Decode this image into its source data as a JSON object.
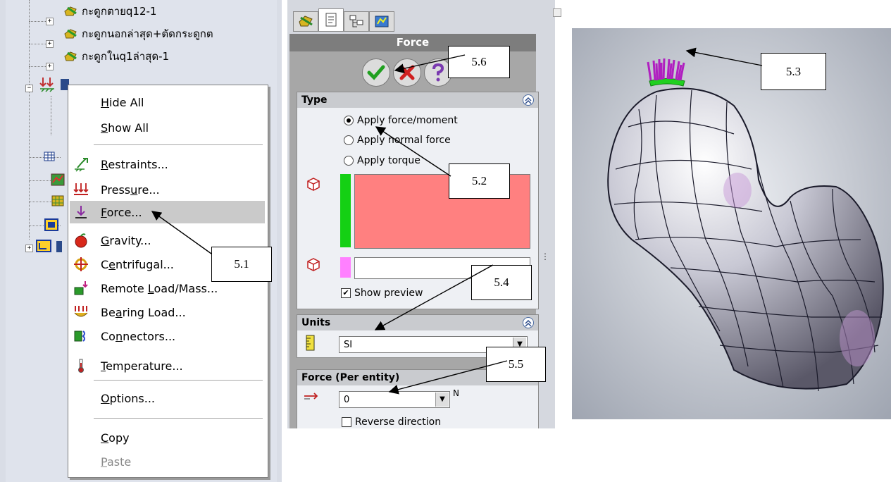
{
  "tree": {
    "items": [
      {
        "label": "กะดูกตายq12-1"
      },
      {
        "label": "กะดูกนอกล่าสุด+ตัดกระดูกต"
      },
      {
        "label": "กะดูกในq1ล่าสุด-1"
      }
    ]
  },
  "context_menu": {
    "items": [
      {
        "mnemonic": "H",
        "rest": "ide All"
      },
      {
        "mnemonic": "S",
        "rest": "how All"
      },
      {
        "mnemonic": "R",
        "rest": "estraints..."
      },
      {
        "pre": "Press",
        "mnemonic": "u",
        "rest": "re..."
      },
      {
        "mnemonic": "F",
        "rest": "orce..."
      },
      {
        "mnemonic": "G",
        "rest": "ravity..."
      },
      {
        "pre": "C",
        "mnemonic": "e",
        "rest": "ntrifugal..."
      },
      {
        "pre": "Remote ",
        "mnemonic": "L",
        "rest": "oad/Mass..."
      },
      {
        "pre": "Be",
        "mnemonic": "a",
        "rest": "ring Load..."
      },
      {
        "pre": "Co",
        "mnemonic": "n",
        "rest": "nectors..."
      },
      {
        "mnemonic": "T",
        "rest": "emperature..."
      },
      {
        "mnemonic": "O",
        "rest": "ptions..."
      },
      {
        "mnemonic": "C",
        "rest": "opy"
      },
      {
        "mnemonic": "P",
        "rest": "aste"
      }
    ],
    "highlighted_item": "Force...",
    "disabled_item": "Paste"
  },
  "property_manager": {
    "title": "Force",
    "type_group": {
      "header": "Type",
      "options": [
        "Apply force/moment",
        "Apply normal force",
        "Apply torque"
      ],
      "selected": "Apply force/moment",
      "show_preview_label": "Show preview",
      "show_preview_checked": true
    },
    "units_group": {
      "header": "Units",
      "value": "SI"
    },
    "force_group": {
      "header": "Force (Per entity)",
      "value": "0",
      "unit": "N",
      "reverse_label": "Reverse direction"
    }
  },
  "callouts": {
    "c51": "5.1",
    "c52": "5.2",
    "c53": "5.3",
    "c54": "5.4",
    "c55": "5.5",
    "c56": "5.6"
  },
  "colors": {
    "selection_pink": "#ff8080",
    "selection_green": "#14d014",
    "selection_magenta": "#ff80ff",
    "menu_highlight": "#cacaca",
    "pm_title": "#7d7d7d"
  }
}
